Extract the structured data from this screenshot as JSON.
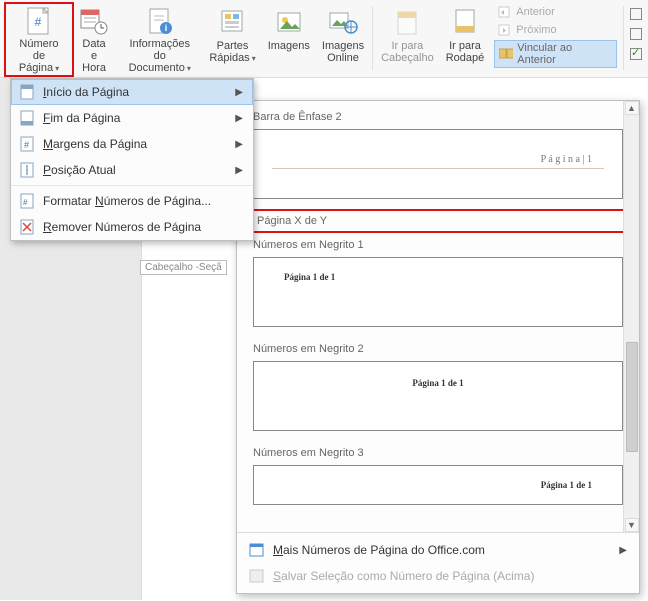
{
  "ribbon": {
    "page_number": {
      "line1": "Número de",
      "line2": "Página"
    },
    "date_time": {
      "line1": "Data e",
      "line2": "Hora"
    },
    "doc_info": {
      "line1": "Informações do",
      "line2": "Documento"
    },
    "quick_parts": {
      "line1": "Partes",
      "line2": "Rápidas"
    },
    "images": {
      "line1": "Imagens",
      "line2": ""
    },
    "images_online": {
      "line1": "Imagens",
      "line2": "Online"
    },
    "goto_header": {
      "line1": "Ir para",
      "line2": "Cabeçalho"
    },
    "goto_footer": {
      "line1": "Ir para",
      "line2": "Rodapé"
    },
    "nav_prev": "Anterior",
    "nav_next": "Próximo",
    "link_prev": "Vincular ao Anterior"
  },
  "submenu": {
    "top_of_page": "Início da Página",
    "bottom_of_page": "Fim da Página",
    "page_margins": "Margens da Página",
    "current_position": "Posição Atual",
    "format_numbers": "Formatar Números de Página...",
    "remove_numbers": "Remover Números de Página"
  },
  "gallery": {
    "section_accent": "Barra de Ênfase 2",
    "accent_preview": "P á g i n a | 1",
    "section_xy": "Página X de Y",
    "section_bold1": "Números em Negrito 1",
    "section_bold2": "Números em Negrito 2",
    "section_bold3": "Números em Negrito 3",
    "bold_preview": "Página 1 de 1",
    "more_office": "Mais Números de Página do Office.com",
    "save_selection": "Salvar Seleção como Número de Página (Acima)"
  },
  "doc_tag": "Cabeçalho -Seçã"
}
